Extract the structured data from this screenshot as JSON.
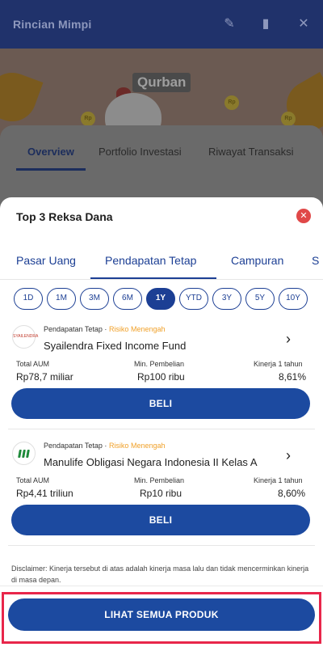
{
  "background": {
    "header_title": "Rincian Mimpi",
    "banner_badge": "Qurban",
    "coin_label": "Rp",
    "tabs": [
      {
        "label": "Overview"
      },
      {
        "label": "Portfolio Investasi"
      },
      {
        "label": "Riwayat Transaksi"
      }
    ],
    "icons": [
      "edit-icon",
      "trash-icon",
      "close-icon"
    ]
  },
  "sheet": {
    "title": "Top 3 Reksa Dana",
    "close_icon": "close-circle-icon",
    "categories": [
      {
        "label": "Pasar Uang"
      },
      {
        "label": "Pendapatan Tetap",
        "active": true
      },
      {
        "label": "Campuran"
      },
      {
        "label": "S"
      }
    ],
    "periods": [
      {
        "label": "1D"
      },
      {
        "label": "1M"
      },
      {
        "label": "3M"
      },
      {
        "label": "6M"
      },
      {
        "label": "1Y",
        "active": true
      },
      {
        "label": "YTD"
      },
      {
        "label": "3Y"
      },
      {
        "label": "5Y"
      },
      {
        "label": "10Y"
      }
    ],
    "funds": [
      {
        "category": "Pendapatan Tetap",
        "separator": "·",
        "risk": "Risiko Menengah",
        "name": "Syailendra Fixed Income Fund",
        "logo_text": "SYAILENDRA",
        "aum_label": "Total AUM",
        "aum_value": "Rp78,7 miliar",
        "min_label": "Min. Pembelian",
        "min_value": "Rp100 ribu",
        "perf_label": "Kinerja 1 tahun",
        "perf_value": "8,61%",
        "buy_label": "BELI"
      },
      {
        "category": "Pendapatan Tetap",
        "separator": "·",
        "risk": "Risiko Menengah",
        "name": "Manulife Obligasi Negara Indonesia II Kelas A",
        "aum_label": "Total AUM",
        "aum_value": "Rp4,41 triliun",
        "min_label": "Min. Pembelian",
        "min_value": "Rp10 ribu",
        "perf_label": "Kinerja 1 tahun",
        "perf_value": "8,60%",
        "buy_label": "BELI"
      }
    ],
    "disclaimer": "Disclaimer: Kinerja tersebut di atas adalah kinerja masa lalu dan tidak mencerminkan kinerja di masa depan.",
    "see_all_label": "LIHAT SEMUA PRODUK"
  },
  "colors": {
    "primary": "#1c4aa0",
    "risk_accent": "#f0a028",
    "close_red": "#e04848",
    "highlight": "#e8264a"
  }
}
